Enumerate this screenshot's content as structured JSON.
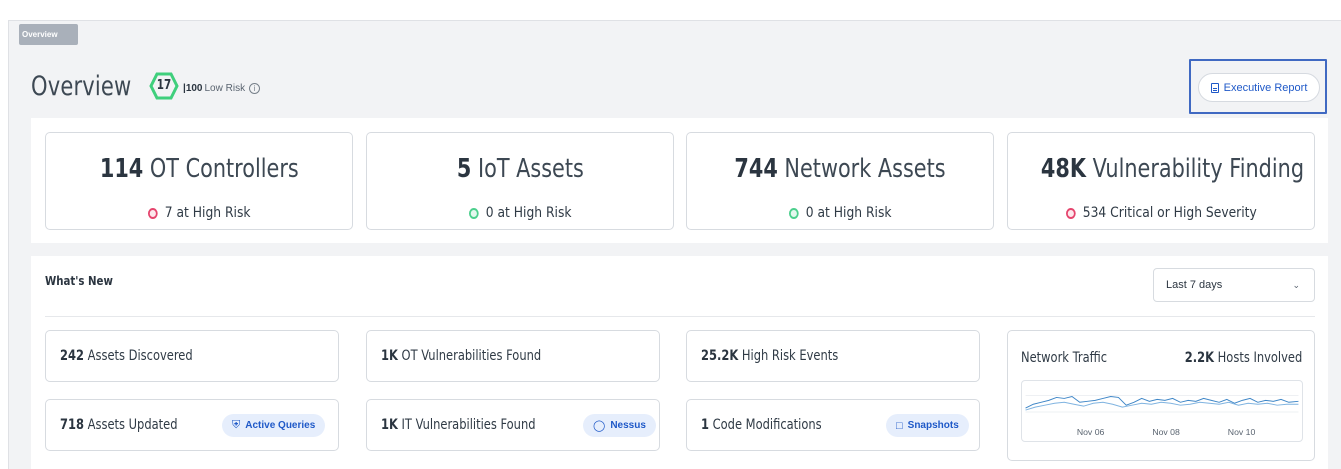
{
  "breadcrumb": "Overview",
  "page_title": "Overview",
  "risk_score": {
    "value": "17",
    "max": "100",
    "label": "Low Risk",
    "info_icon": "info-icon"
  },
  "executive_report": {
    "label": "Executive Report",
    "icon": "report-icon"
  },
  "kpis": [
    {
      "value": "114",
      "label": "OT Controllers",
      "sub": "7 at High Risk",
      "status": "red"
    },
    {
      "value": "5",
      "label": "IoT Assets",
      "sub": "0 at High Risk",
      "status": "green"
    },
    {
      "value": "744",
      "label": "Network Assets",
      "sub": "0 at High Risk",
      "status": "green"
    },
    {
      "value": "48K",
      "label": "Vulnerability Finding",
      "sub": "534 Critical or High Severity",
      "status": "red"
    }
  ],
  "whats_new": {
    "title": "What's New",
    "range": "Last 7 days",
    "cards": [
      {
        "value": "242",
        "label": "Assets Discovered"
      },
      {
        "value": "1K",
        "label": "OT Vulnerabilities Found"
      },
      {
        "value": "25.2K",
        "label": "High Risk Events"
      },
      {
        "value": "718",
        "label": "Assets Updated",
        "badge": "Active Queries"
      },
      {
        "value": "1K",
        "label": "IT Vulnerabilities Found",
        "badge": "Nessus"
      },
      {
        "value": "1",
        "label": "Code Modifications",
        "badge": "Snapshots"
      }
    ],
    "traffic": {
      "label": "Network Traffic",
      "hosts_value": "2.2K",
      "hosts_label": "Hosts Involved",
      "ticks": [
        "Nov 06",
        "Nov 08",
        "Nov 10"
      ]
    }
  },
  "colors": {
    "accent": "#1f59c8",
    "risk_green": "#3fcf7c",
    "red": "#e5446d",
    "green": "#4ccf8d"
  }
}
